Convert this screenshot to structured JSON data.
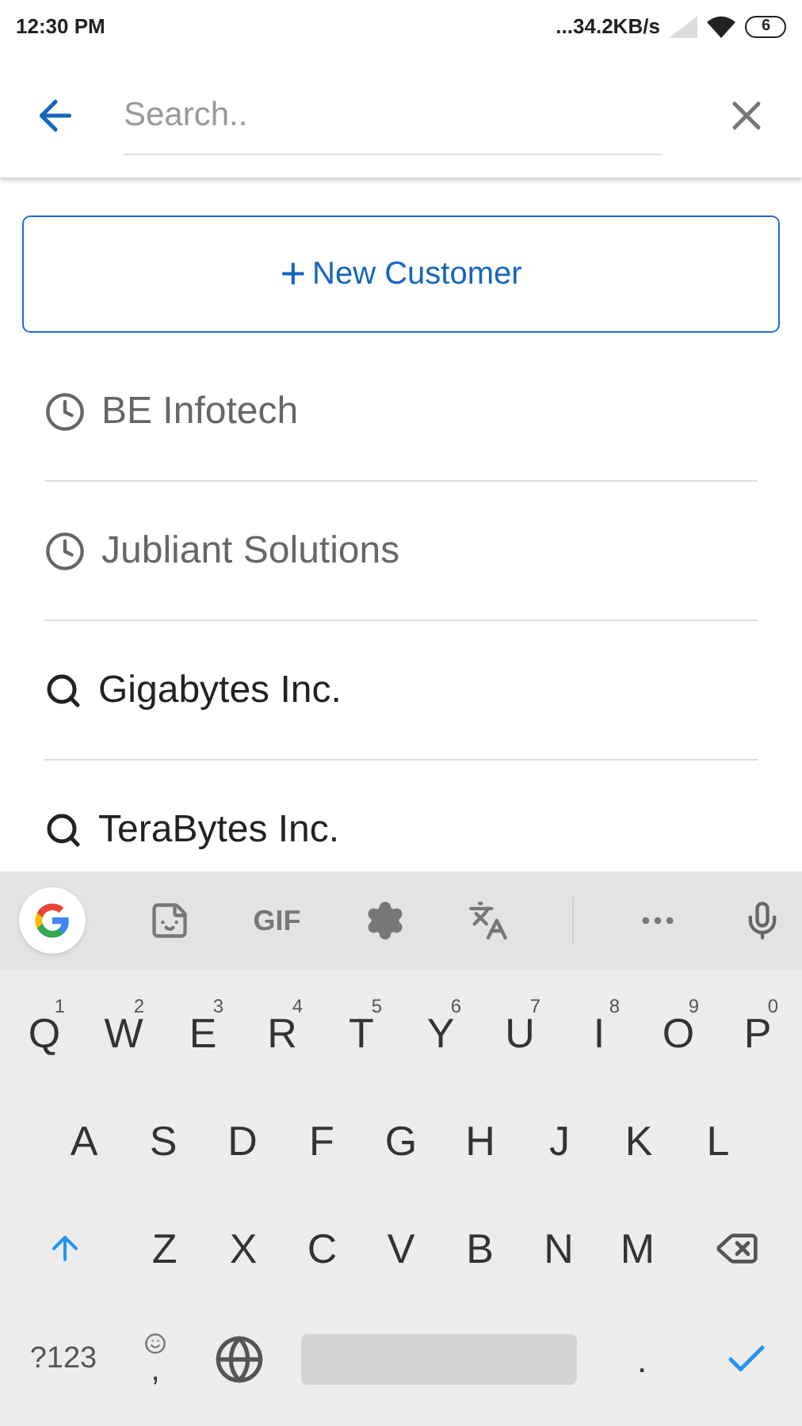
{
  "status_bar": {
    "time": "12:30 PM",
    "network_speed": "...34.2KB/s",
    "battery": "6"
  },
  "search": {
    "placeholder": "Search.."
  },
  "new_customer_button": {
    "icon": "+",
    "label": "New Customer"
  },
  "suggestions": [
    {
      "kind": "recent",
      "label": "BE Infotech"
    },
    {
      "kind": "recent",
      "label": "Jubliant Solutions"
    },
    {
      "kind": "search",
      "label": "Gigabytes Inc."
    },
    {
      "kind": "search",
      "label": "TeraBytes Inc."
    }
  ],
  "keyboard": {
    "toolbar_label": "GIF",
    "rows": [
      [
        {
          "label": "Q",
          "hint": "1"
        },
        {
          "label": "W",
          "hint": "2"
        },
        {
          "label": "E",
          "hint": "3"
        },
        {
          "label": "R",
          "hint": "4"
        },
        {
          "label": "T",
          "hint": "5"
        },
        {
          "label": "Y",
          "hint": "6"
        },
        {
          "label": "U",
          "hint": "7"
        },
        {
          "label": "I",
          "hint": "8"
        },
        {
          "label": "O",
          "hint": "9"
        },
        {
          "label": "P",
          "hint": "0"
        }
      ],
      [
        {
          "label": "A"
        },
        {
          "label": "S"
        },
        {
          "label": "D"
        },
        {
          "label": "F"
        },
        {
          "label": "G"
        },
        {
          "label": "H"
        },
        {
          "label": "J"
        },
        {
          "label": "K"
        },
        {
          "label": "L"
        }
      ],
      [
        {
          "label": "Z"
        },
        {
          "label": "X"
        },
        {
          "label": "C"
        },
        {
          "label": "V"
        },
        {
          "label": "B"
        },
        {
          "label": "N"
        },
        {
          "label": "M"
        }
      ]
    ],
    "symbols_key": "?123",
    "comma_key": ",",
    "period_key": "."
  }
}
